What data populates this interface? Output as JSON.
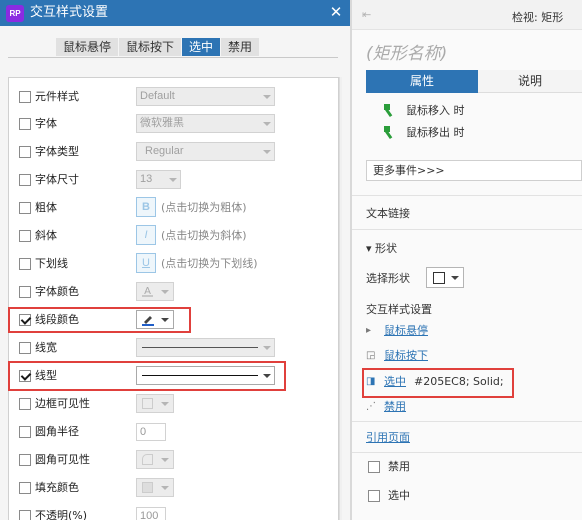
{
  "dialog": {
    "app_icon": "RP",
    "title": "交互样式设置",
    "close_glyph": "✕",
    "tabs": [
      "鼠标悬停",
      "鼠标按下",
      "选中",
      "禁用"
    ],
    "active_tab": "选中",
    "rows": [
      {
        "label": "元件样式",
        "control": "Default",
        "checked": false
      },
      {
        "label": "字体",
        "control": "微软雅黑",
        "checked": false
      },
      {
        "label": "字体类型",
        "control": "Regular",
        "checked": false
      },
      {
        "label": "字体尺寸",
        "control": "13",
        "checked": false
      },
      {
        "label": "粗体",
        "button": "B",
        "hint": "(点击切换为粗体)",
        "checked": false
      },
      {
        "label": "斜体",
        "button": "I",
        "hint": "(点击切换为斜体)",
        "checked": false
      },
      {
        "label": "下划线",
        "button": "U",
        "hint": "(点击切换为下划线)",
        "checked": false
      },
      {
        "label": "字体颜色",
        "checked": false
      },
      {
        "label": "线段颜色",
        "checked": true
      },
      {
        "label": "线宽",
        "checked": false
      },
      {
        "label": "线型",
        "checked": true
      },
      {
        "label": "边框可见性",
        "checked": false
      },
      {
        "label": "圆角半径",
        "control": "0",
        "checked": false
      },
      {
        "label": "圆角可见性",
        "checked": false
      },
      {
        "label": "填充颜色",
        "checked": false
      },
      {
        "label": "不透明(%)",
        "control": "100",
        "checked": false
      }
    ],
    "colors": {
      "line_color": "#205EC8",
      "title_bar": "#2d74b4",
      "highlight": "#e0403c"
    }
  },
  "inspector": {
    "back_icon": "⇤",
    "title": "检视: 矩形",
    "shape_name": "(矩形名称)",
    "tabs": [
      "属性",
      "说明"
    ],
    "events": [
      "鼠标移入 时",
      "鼠标移出 时"
    ],
    "more_events": "更多事件>>>",
    "text_link": "文本链接",
    "shape_section": "▾  形状",
    "select_shape_label": "选择形状",
    "interaction_title": "交互样式设置",
    "links": [
      {
        "label": "鼠标悬停",
        "icon": "hover-style-icon",
        "value": ""
      },
      {
        "label": "鼠标按下",
        "icon": "pressed-style-icon",
        "value": ""
      },
      {
        "label": "选中",
        "icon": "selected-style-icon",
        "value": "#205EC8; Solid;"
      },
      {
        "label": "禁用",
        "icon": "disabled-style-icon",
        "value": ""
      }
    ],
    "ref_page": "引用页面",
    "disabled_label": "禁用",
    "selected_label": "选中"
  }
}
